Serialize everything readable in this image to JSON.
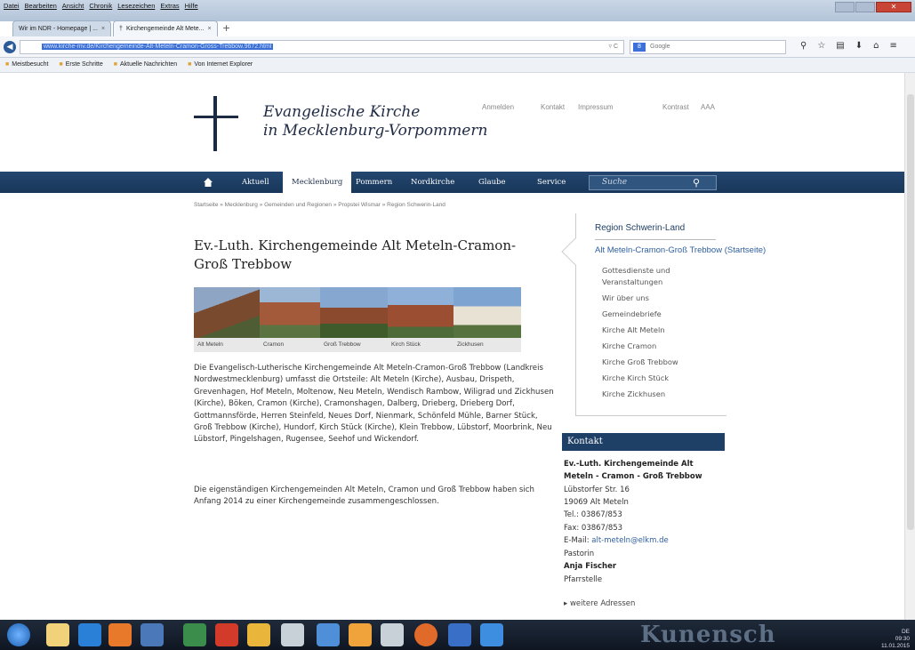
{
  "browser": {
    "menu": [
      "Datei",
      "Bearbeiten",
      "Ansicht",
      "Chronik",
      "Lesezeichen",
      "Extras",
      "Hilfe"
    ],
    "tabs": [
      {
        "label": "Wir im NDR - Homepage | ..."
      },
      {
        "label": "Kirchengemeinde Alt Mete..."
      }
    ],
    "url": "www.kirche-mv.de/Kirchengemeinde-Alt-Meteln-Cramon-Gross-Trebbow.9672.html",
    "search_placeholder": "Google",
    "bookmarks": [
      "Meistbesucht",
      "Erste Schritte",
      "Aktuelle Nachrichten",
      "Von Internet Explorer"
    ]
  },
  "site": {
    "title_line1": "Evangelische Kirche",
    "title_line2": "in Mecklenburg-Vorpommern",
    "toplinks": [
      "Anmelden",
      "Kontakt",
      "Impressum",
      "Kontrast",
      "AAA"
    ]
  },
  "nav": {
    "items": [
      "Aktuell",
      "Mecklenburg",
      "Pommern",
      "Nordkirche",
      "Glaube",
      "Service"
    ],
    "search_placeholder": "Suche"
  },
  "breadcrumb": "Startseite » Mecklenburg » Gemeinden und Regionen » Propstei Wismar » Region Schwerin-Land",
  "main": {
    "title": "Ev.-Luth. Kirchengemeinde Alt Meteln-Cramon-Groß Trebbow",
    "photos": [
      "Alt Meteln",
      "Cramon",
      "Groß Trebbow",
      "Kirch Stück",
      "Zickhusen"
    ],
    "paragraph1": "Die Evangelisch-Lutherische Kirchengemeinde Alt Meteln-Cramon-Groß Trebbow (Landkreis Nordwestmecklenburg) umfasst die Ortsteile: Alt Meteln (Kirche), Ausbau, Drispeth, Grevenhagen, Hof Meteln, Moltenow, Neu Meteln, Wendisch Rambow, Wiligrad und Zickhusen (Kirche), Böken, Cramon (Kirche), Cramonshagen, Dalberg, Drieberg, Drieberg Dorf, Gottmannsförde, Herren Steinfeld, Neues Dorf, Nienmark, Schönfeld Mühle, Barner Stück, Groß Trebbow (Kirche), Hundorf, Kirch Stück (Kirche), Klein Trebbow, Lübstorf, Moorbrink, Neu Lübstorf, Pingelshagen, Rugensee, Seehof und Wickendorf.",
    "paragraph2": "Die eigenständigen Kirchengemeinden Alt Meteln, Cramon und Groß Trebbow haben sich Anfang 2014 zu einer Kirchengemeinde zusammengeschlossen."
  },
  "sidebar": {
    "region": "Region Schwerin-Land",
    "current": "Alt Meteln-Cramon-Groß Trebbow (Startseite)",
    "items": [
      "Gottesdienste und Veranstaltungen",
      "Wir über uns",
      "Gemeindebriefe",
      "Kirche Alt Meteln",
      "Kirche Cramon",
      "Kirche Groß Trebbow",
      "Kirche Kirch Stück",
      "Kirche Zickhusen"
    ]
  },
  "kontakt": {
    "header": "Kontakt",
    "name_line1": "Ev.-Luth. Kirchengemeinde Alt",
    "name_line2": "Meteln - Cramon - Groß Trebbow",
    "street": "Lübstorfer Str. 16",
    "city": "19069 Alt Meteln",
    "tel": "Tel.: 03867/853",
    "fax": "Fax: 03867/853",
    "email_label": "E-Mail: ",
    "email": "alt-meteln@elkm.de",
    "role": "Pastorin",
    "person": "Anja Fischer",
    "office": "Pfarrstelle",
    "more": "weitere Adressen"
  },
  "taskbar": {
    "background_text": "Kunensch",
    "tray_lang": "DE",
    "time": "09:30",
    "date": "11.01.2015"
  },
  "colors": {
    "navy": "#1e3f66",
    "link": "#2e5fa0"
  }
}
